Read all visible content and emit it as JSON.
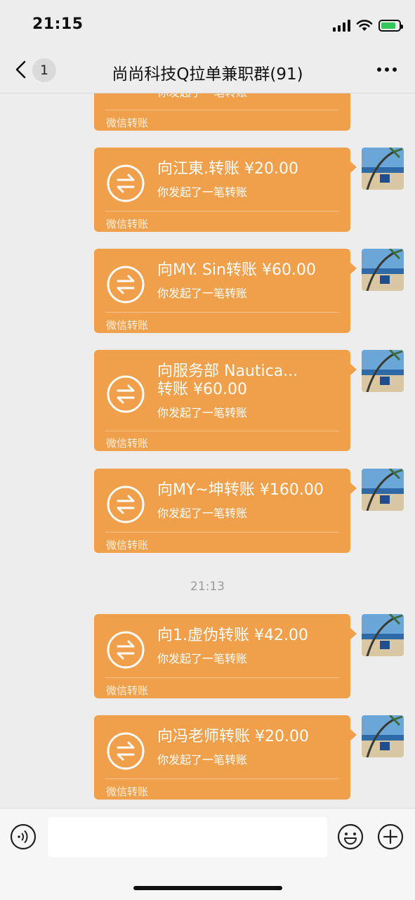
{
  "status_bar": {
    "time": "21:15"
  },
  "nav": {
    "back_icon": "chevron-left-icon",
    "unread_count": "1",
    "title": "尚尚科技Q拉单兼职群(91)",
    "more_icon": "more-dots-icon"
  },
  "messages": [
    {
      "title": "你发起了一笔转账",
      "subtitle": "",
      "footer": "微信转账",
      "partial": true
    },
    {
      "title": "向江東.转账 ¥20.00",
      "subtitle": "你发起了一笔转账",
      "footer": "微信转账"
    },
    {
      "title": "向MY. Sin转账 ¥60.00",
      "subtitle": "你发起了一笔转账",
      "footer": "微信转账"
    },
    {
      "title": "向服务部 Nautica...",
      "title2": "转账 ¥60.00",
      "subtitle": "你发起了一笔转账",
      "footer": "微信转账"
    },
    {
      "title": "向MY~坤转账 ¥160.00",
      "subtitle": "你发起了一笔转账",
      "footer": "微信转账"
    },
    {
      "title": "向1.虚伪转账 ¥42.00",
      "subtitle": "你发起了一笔转账",
      "footer": "微信转账"
    },
    {
      "title": "向冯老师转账 ¥20.00",
      "subtitle": "你发起了一笔转账",
      "footer": "微信转账"
    }
  ],
  "timestamp": "21:13",
  "input_bar": {
    "voice_icon": "voice-icon",
    "emoji_icon": "emoji-icon",
    "plus_icon": "plus-icon",
    "placeholder": ""
  },
  "colors": {
    "transfer_bubble": "#f0a04b",
    "background": "#ededed",
    "battery_fill": "#34c759"
  },
  "transfer_icon": "transfer-arrows-icon"
}
